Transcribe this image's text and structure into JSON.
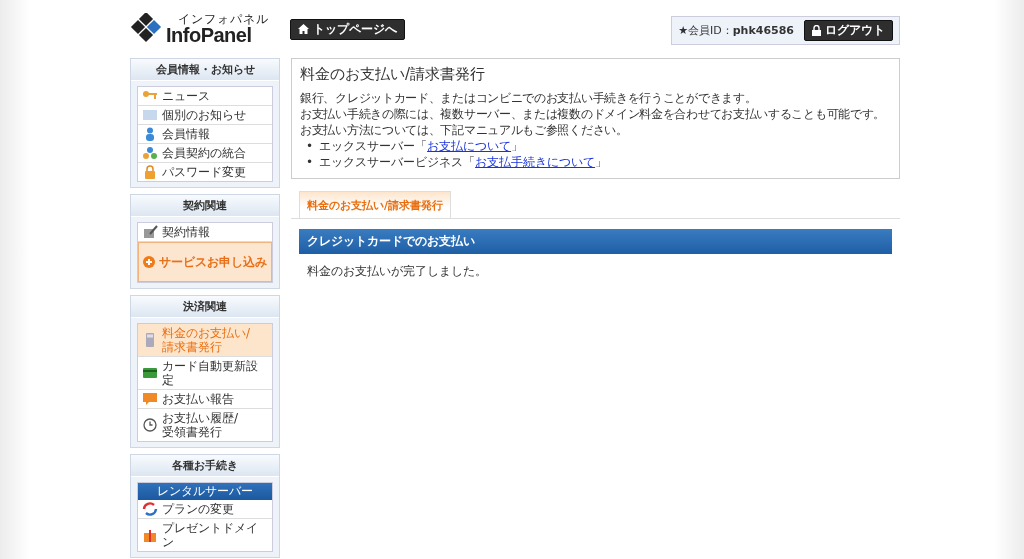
{
  "header": {
    "logo_kana": "インフォパネル",
    "logo_text": "InfoPanel",
    "top_button": "トップページへ",
    "member_id_label": "★会員ID：",
    "member_id": "phk46586",
    "logout_button": "ログアウト"
  },
  "sidebar": [
    {
      "title": "会員情報・お知らせ",
      "items": [
        {
          "kind": "link",
          "label": "ニュース",
          "selected": false
        },
        {
          "kind": "link",
          "label": "個別のお知らせ",
          "selected": false
        },
        {
          "kind": "link",
          "label": "会員情報",
          "selected": false
        },
        {
          "kind": "link",
          "label": "会員契約の統合",
          "selected": false
        },
        {
          "kind": "link",
          "label": "パスワード変更",
          "selected": false
        }
      ]
    },
    {
      "title": "契約関連",
      "items": [
        {
          "kind": "link",
          "label": "契約情報",
          "selected": false
        },
        {
          "kind": "promo",
          "label": "サービスお申し込み",
          "selected": false
        }
      ]
    },
    {
      "title": "決済関連",
      "items": [
        {
          "kind": "link",
          "label": "料金のお支払い/\n請求書発行",
          "selected": true
        },
        {
          "kind": "link",
          "label": "カード自動更新設定",
          "selected": false
        },
        {
          "kind": "link",
          "label": "お支払い報告",
          "selected": false
        },
        {
          "kind": "link",
          "label": "お支払い履歴/\n受領書発行",
          "selected": false
        }
      ]
    },
    {
      "title": "各種お手続き",
      "items": [
        {
          "kind": "subheader",
          "label": "レンタルサーバー",
          "selected": false
        },
        {
          "kind": "link",
          "label": "プランの変更",
          "selected": false
        },
        {
          "kind": "link",
          "label": "プレゼントドメイン",
          "selected": false
        }
      ]
    }
  ],
  "main": {
    "title": "料金のお支払い/請求書発行",
    "paragraphs": [
      "銀行、クレジットカード、またはコンビニでのお支払い手続きを行うことができます。",
      "お支払い手続きの際には、複数サーバー、または複数のドメイン料金を合わせてお支払いすることも可能です。",
      "お支払い方法については、下記マニュアルもご参照ください。"
    ],
    "manual_links": [
      {
        "bullet": "•",
        "prefix": "エックスサーバー「",
        "link": "お支払について",
        "suffix": "」"
      },
      {
        "bullet": "•",
        "prefix": "エックスサーバービジネス「",
        "link": "お支払手続きについて",
        "suffix": "」"
      }
    ],
    "tabs": [
      {
        "label": "料金のお支払い/請求書発行",
        "selected": true
      }
    ],
    "section_title": "クレジットカードでのお支払い",
    "message": "料金のお支払いが完了しました。"
  }
}
